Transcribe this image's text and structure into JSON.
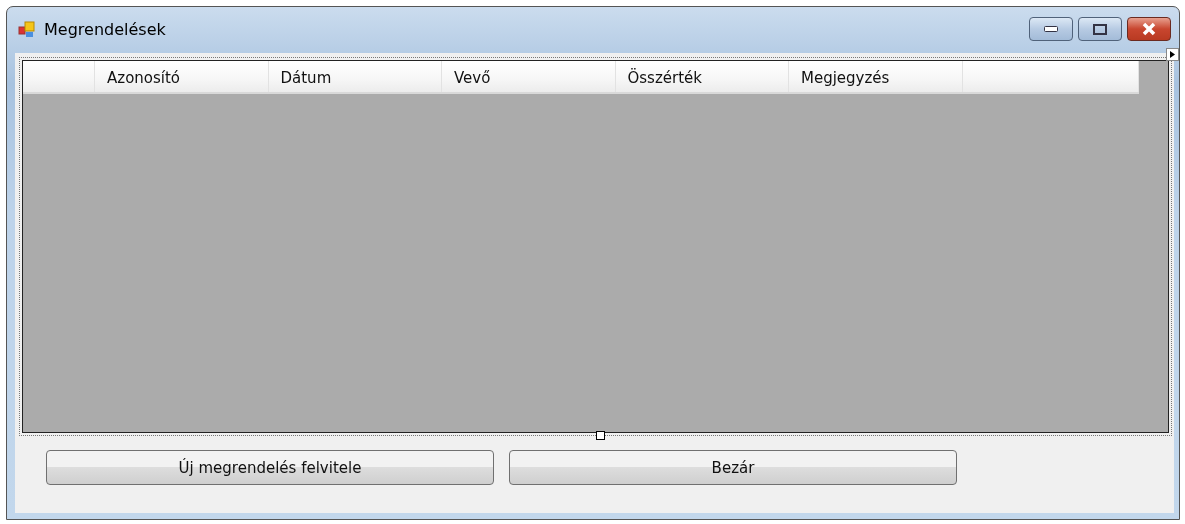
{
  "window": {
    "title": "Megrendelések"
  },
  "grid": {
    "columns": [
      "Azonosító",
      "Dátum",
      "Vevő",
      "Összérték",
      "Megjegyzés"
    ]
  },
  "buttons": [
    "Új megrendelés felvitele",
    "Bezár"
  ]
}
